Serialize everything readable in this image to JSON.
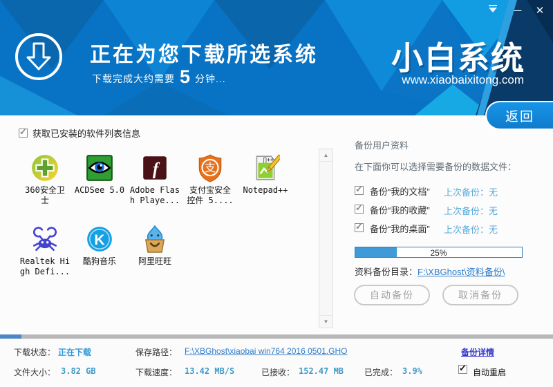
{
  "window": {
    "minimize_glyph": "─",
    "close_glyph": "✕"
  },
  "header": {
    "title": "正在为您下载所选系统",
    "subtitle_prefix": "下载完成大约需要",
    "subtitle_number": "5",
    "subtitle_suffix": "分钟...",
    "logo": "小白系统",
    "website": "www.xiaobaixitong.com",
    "back_button": "返回"
  },
  "software_section": {
    "checkbox_label": "获取已安装的软件列表信息",
    "checkbox_checked": true,
    "items": [
      {
        "icon": "360-safe-icon",
        "label": "360安全卫\n士"
      },
      {
        "icon": "acdsee-icon",
        "label": "ACDSee 5.0"
      },
      {
        "icon": "adobe-flash-icon",
        "label": "Adobe Flas\nh Playe..."
      },
      {
        "icon": "alipay-shield-icon",
        "label": "支付宝安全\n控件 5...."
      },
      {
        "icon": "notepad-plus-icon",
        "label": "Notepad++"
      },
      {
        "icon": "realtek-audio-icon",
        "label": "Realtek Hi\ngh Defi..."
      },
      {
        "icon": "kugou-music-icon",
        "label": "酷狗音乐"
      },
      {
        "icon": "ali-wangwang-icon",
        "label": "阿里旺旺"
      }
    ]
  },
  "backup_panel": {
    "title": "备份用户资料",
    "subtitle": "在下面你可以选择需要备份的数据文件：",
    "options": [
      {
        "label": "备份“我的文档”",
        "last_backup": "上次备份：无",
        "checked": true
      },
      {
        "label": "备份“我的收藏”",
        "last_backup": "上次备份：无",
        "checked": true
      },
      {
        "label": "备份“我的桌面”",
        "last_backup": "上次备份：无",
        "checked": true
      }
    ],
    "progress_percent": 25,
    "progress_label": "25%",
    "directory_label": "资料备份目录：",
    "directory_link": "F:\\XBGhost\\资料备份\\",
    "auto_backup_button": "自动备份",
    "cancel_backup_button": "取消备份"
  },
  "status_bar": {
    "download_progress_percent": 3.9,
    "status_label": "下载状态：",
    "status_value": "正在下载",
    "path_label": "保存路径：",
    "path_link": "F:\\XBGhost\\xiaobai win764 2016 0501.GHO",
    "backup_details_link": "备份详情",
    "size_label": "文件大小：",
    "size_value": "3.82 GB",
    "speed_label": "下载速度：",
    "speed_value": "13.42 MB/S",
    "received_label": "已接收：",
    "received_value": "152.47 MB",
    "completed_label": "已完成：",
    "completed_value": "3.9%",
    "auto_restart_label": "自动重启",
    "auto_restart_checked": true
  },
  "colors": {
    "header_blue": "#0873c4",
    "header_dark_navy": "#0a3a68",
    "accent_blue": "#1287dd",
    "link_blue": "#2e7cc9",
    "link_indigo": "#3237c8",
    "value_teal": "#3e9ac8",
    "status_blue": "#2f9ade",
    "progress_fill": "#3f9bd8",
    "strip_fill": "#4a86c8",
    "strip_track": "#b8b8b8"
  }
}
